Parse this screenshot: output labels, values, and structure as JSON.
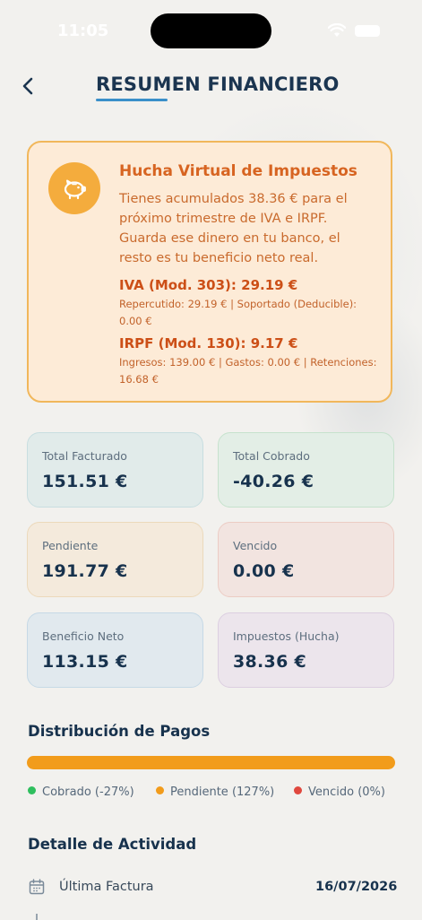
{
  "status_bar": {
    "time": "11:05"
  },
  "header": {
    "title": "RESUMEN FINANCIERO"
  },
  "hucha": {
    "title": "Hucha Virtual de Impuestos",
    "description": "Tienes acumulados 38.36 € para el próximo trimestre de IVA e IRPF. Guarda ese dinero en tu banco, el resto es tu beneficio neto real.",
    "iva_title": "IVA (Mod. 303): 29.19 €",
    "iva_detail": "Repercutido: 29.19 € | Soportado (Deducible): 0.00 €",
    "irpf_title": "IRPF (Mod. 130): 9.17 €",
    "irpf_detail": "Ingresos: 139.00 € | Gastos: 0.00 € | Retenciones: 16.68 €"
  },
  "stats": [
    {
      "label": "Total Facturado",
      "value": "151.51 €",
      "bg": "#e1ebea",
      "border": "#c8dee0"
    },
    {
      "label": "Total Cobrado",
      "value": "-40.26 €",
      "bg": "#e3eee6",
      "border": "#c6e2cd"
    },
    {
      "label": "Pendiente",
      "value": "191.77 €",
      "bg": "#f4eadc",
      "border": "#ecd9bb"
    },
    {
      "label": "Vencido",
      "value": "0.00 €",
      "bg": "#f2e4e0",
      "border": "#ecccc4"
    },
    {
      "label": "Beneficio Neto",
      "value": "113.15 €",
      "bg": "#e1e9ee",
      "border": "#c6d9e6"
    },
    {
      "label": "Impuestos (Hucha)",
      "value": "38.36 €",
      "bg": "#ece5ec",
      "border": "#dccfe0"
    }
  ],
  "distribution": {
    "title": "Distribución de Pagos",
    "bar_color": "#f29c1b",
    "legend": [
      {
        "label": "Cobrado (-27%)",
        "color": "#2fbf5e"
      },
      {
        "label": "Pendiente (127%)",
        "color": "#f29c1b"
      },
      {
        "label": "Vencido (0%)",
        "color": "#e0483e"
      }
    ]
  },
  "activity": {
    "title": "Detalle de Actividad",
    "rows": [
      {
        "label": "Última Factura",
        "value": "16/07/2026",
        "icon": "calendar-icon"
      }
    ]
  }
}
